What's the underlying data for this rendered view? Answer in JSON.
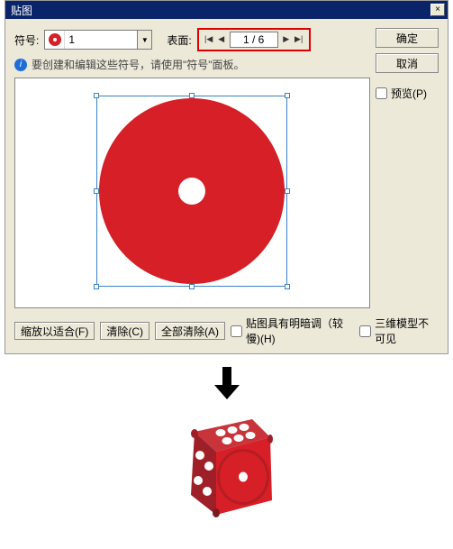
{
  "dialog": {
    "title": "贴图",
    "close": "×"
  },
  "symbol": {
    "label": "符号:",
    "value": "1"
  },
  "surface": {
    "label": "表面:",
    "value": "1 / 6",
    "first": "|◀",
    "prev": "◀",
    "next": "▶",
    "last": "▶|"
  },
  "buttons": {
    "ok": "确定",
    "cancel": "取消"
  },
  "preview": {
    "label": "预览(P)"
  },
  "hint": "要创建和编辑这些符号，请使用\"符号\"面板。",
  "bottom": {
    "fit": "缩放以适合(F)",
    "clear": "清除(C)",
    "clearAll": "全部清除(A)",
    "shade": "贴图具有明暗调（较慢)(H)",
    "hide3d": "三维模型不可见"
  },
  "icons": {
    "dropdown": "▼"
  }
}
